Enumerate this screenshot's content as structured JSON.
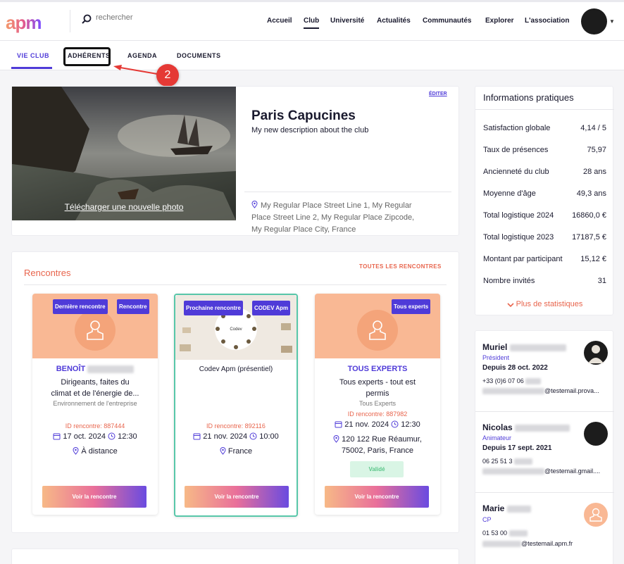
{
  "header": {
    "logo": "apm",
    "search_placeholder": "rechercher",
    "nav": [
      "Accueil",
      "Club",
      "Université",
      "Actualités",
      "Communautés",
      "Explorer",
      "L'association"
    ],
    "active_nav": "Club"
  },
  "subnav": {
    "tabs": [
      "VIE CLUB",
      "ADHÉRENTS",
      "AGENDA",
      "DOCUMENTS"
    ],
    "active_tab": "VIE CLUB",
    "step_badge": "2"
  },
  "club": {
    "edit_label": "ÉDITER",
    "upload_label": "Télécharger une nouvelle photo",
    "name": "Paris Capucines",
    "description": "My new description about the club",
    "address_lines": [
      "My Regular Place Street Line 1, My Regular",
      "Place Street Line 2, My Regular Place Zipcode,",
      "My Regular Place City, France"
    ]
  },
  "meetings": {
    "title": "Rencontres",
    "all_link": "TOUTES LES RENCONTRES",
    "button_label": "Voir la rencontre",
    "cards": [
      {
        "tags": [
          "Dernière rencontre",
          "Rencontre"
        ],
        "name": "BENOÎT",
        "lines": [
          "Dirigeants, faites du",
          "climat et de l'énergie de..."
        ],
        "subtitle": "Environnement de l'entreprise",
        "id": "ID rencontre: 887444",
        "date": "17 oct. 2024",
        "time": "12:30",
        "place_lines": [
          "À distance"
        ]
      },
      {
        "tags": [
          "Prochaine rencontre",
          "CODEV Apm"
        ],
        "image_text": "Codev",
        "title": "Codev Apm (présentiel)",
        "id": "ID rencontre: 892116",
        "date": "21 nov. 2024",
        "time": "10:00",
        "place_lines": [
          "France"
        ]
      },
      {
        "tags": [
          "Tous experts"
        ],
        "name": "TOUS EXPERTS",
        "lines": [
          "Tous experts - tout est",
          "permis"
        ],
        "subtitle": "Tous Experts",
        "id": "ID rencontre: 887982",
        "date": "21 nov. 2024",
        "time": "12:30",
        "place_lines": [
          "120 122 Rue Réaumur,",
          "75002, Paris, France"
        ],
        "status": "Validé"
      }
    ]
  },
  "info": {
    "title": "Informations pratiques",
    "rows": [
      {
        "label": "Satisfaction globale",
        "value": "4,14 / 5"
      },
      {
        "label": "Taux de présences",
        "value": "75,97"
      },
      {
        "label": "Ancienneté du club",
        "value": "28 ans"
      },
      {
        "label": "Moyenne d'âge",
        "value": "49,3 ans"
      },
      {
        "label": "Total logistique 2024",
        "value": "16860,0 €"
      },
      {
        "label": "Total logistique 2023",
        "value": "17187,5 €"
      },
      {
        "label": "Montant par participant",
        "value": "15,12 €"
      },
      {
        "label": "Nombre invités",
        "value": "31"
      }
    ],
    "more_label": "Plus de statistiques"
  },
  "people": [
    {
      "name": "Muriel",
      "role": "Président",
      "since": "Depuis 28 oct. 2022",
      "phone": "+33 (0)6 07 06",
      "email": "@testemail.prova..."
    },
    {
      "name": "Nicolas",
      "role": "Animateur",
      "since": "Depuis 17 sept. 2021",
      "phone": "06 25 51 3",
      "email": "@testemail.gmail...."
    },
    {
      "name": "Marie",
      "role": "CP",
      "phone": "01 53 00",
      "email": "@testemail.apm.fr"
    }
  ],
  "colors": {
    "accent": "#4f3bd8",
    "coral": "#e8654d",
    "peach": "#f9b894",
    "teal": "#58c7a9"
  }
}
